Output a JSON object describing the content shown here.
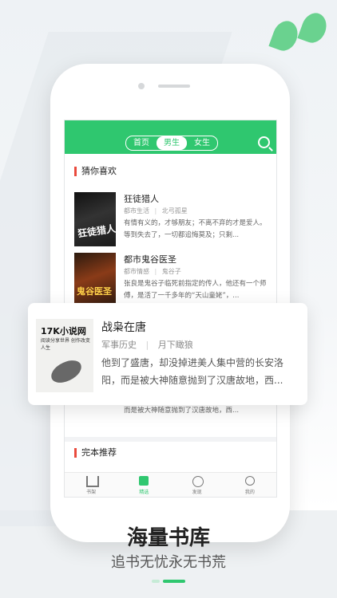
{
  "header": {
    "tabs": [
      {
        "label": "首页",
        "active": false
      },
      {
        "label": "男生",
        "active": true
      },
      {
        "label": "女生",
        "active": false
      }
    ],
    "search_icon": "search-icon",
    "accent_color": "#2fc76f"
  },
  "sections": {
    "guess_title": "猜你喜欢",
    "finished_title": "完本推荐"
  },
  "books": [
    {
      "title": "狂徒猎人",
      "category": "都市生活",
      "author": "北弓孤星",
      "desc": "有情有义的，才够朋友；不离不弃的才是爱人。等到失去了，一切都追悔莫及；只剩...",
      "cover_text": "狂徒猎人"
    },
    {
      "title": "都市鬼谷医圣",
      "category": "都市情感",
      "author": "鬼谷子",
      "desc": "张良是鬼谷子临死前指定的传人，他还有一个师傅，是活了一千多年的“天山童姥”，...",
      "cover_text": "鬼谷医圣"
    }
  ],
  "popup_book": {
    "title": "战枭在唐",
    "category": "军事历史",
    "author": "月下瞰狼",
    "desc": "他到了盛唐，却没掉进美人集中营的长安洛阳，而是被大神随意抛到了汉唐故地，西...",
    "cover_brand": "17K小说网",
    "cover_sub": "阅读分享世界 创作改变人生"
  },
  "bottom_nav": [
    {
      "label": "书架",
      "icon": "bookshelf-icon",
      "active": false
    },
    {
      "label": "精选",
      "icon": "featured-icon",
      "active": true
    },
    {
      "label": "发现",
      "icon": "discover-icon",
      "active": false
    },
    {
      "label": "我的",
      "icon": "profile-icon",
      "active": false
    }
  ],
  "promo": {
    "headline": "海量书库",
    "subline": "追书无忧永无书荒"
  }
}
